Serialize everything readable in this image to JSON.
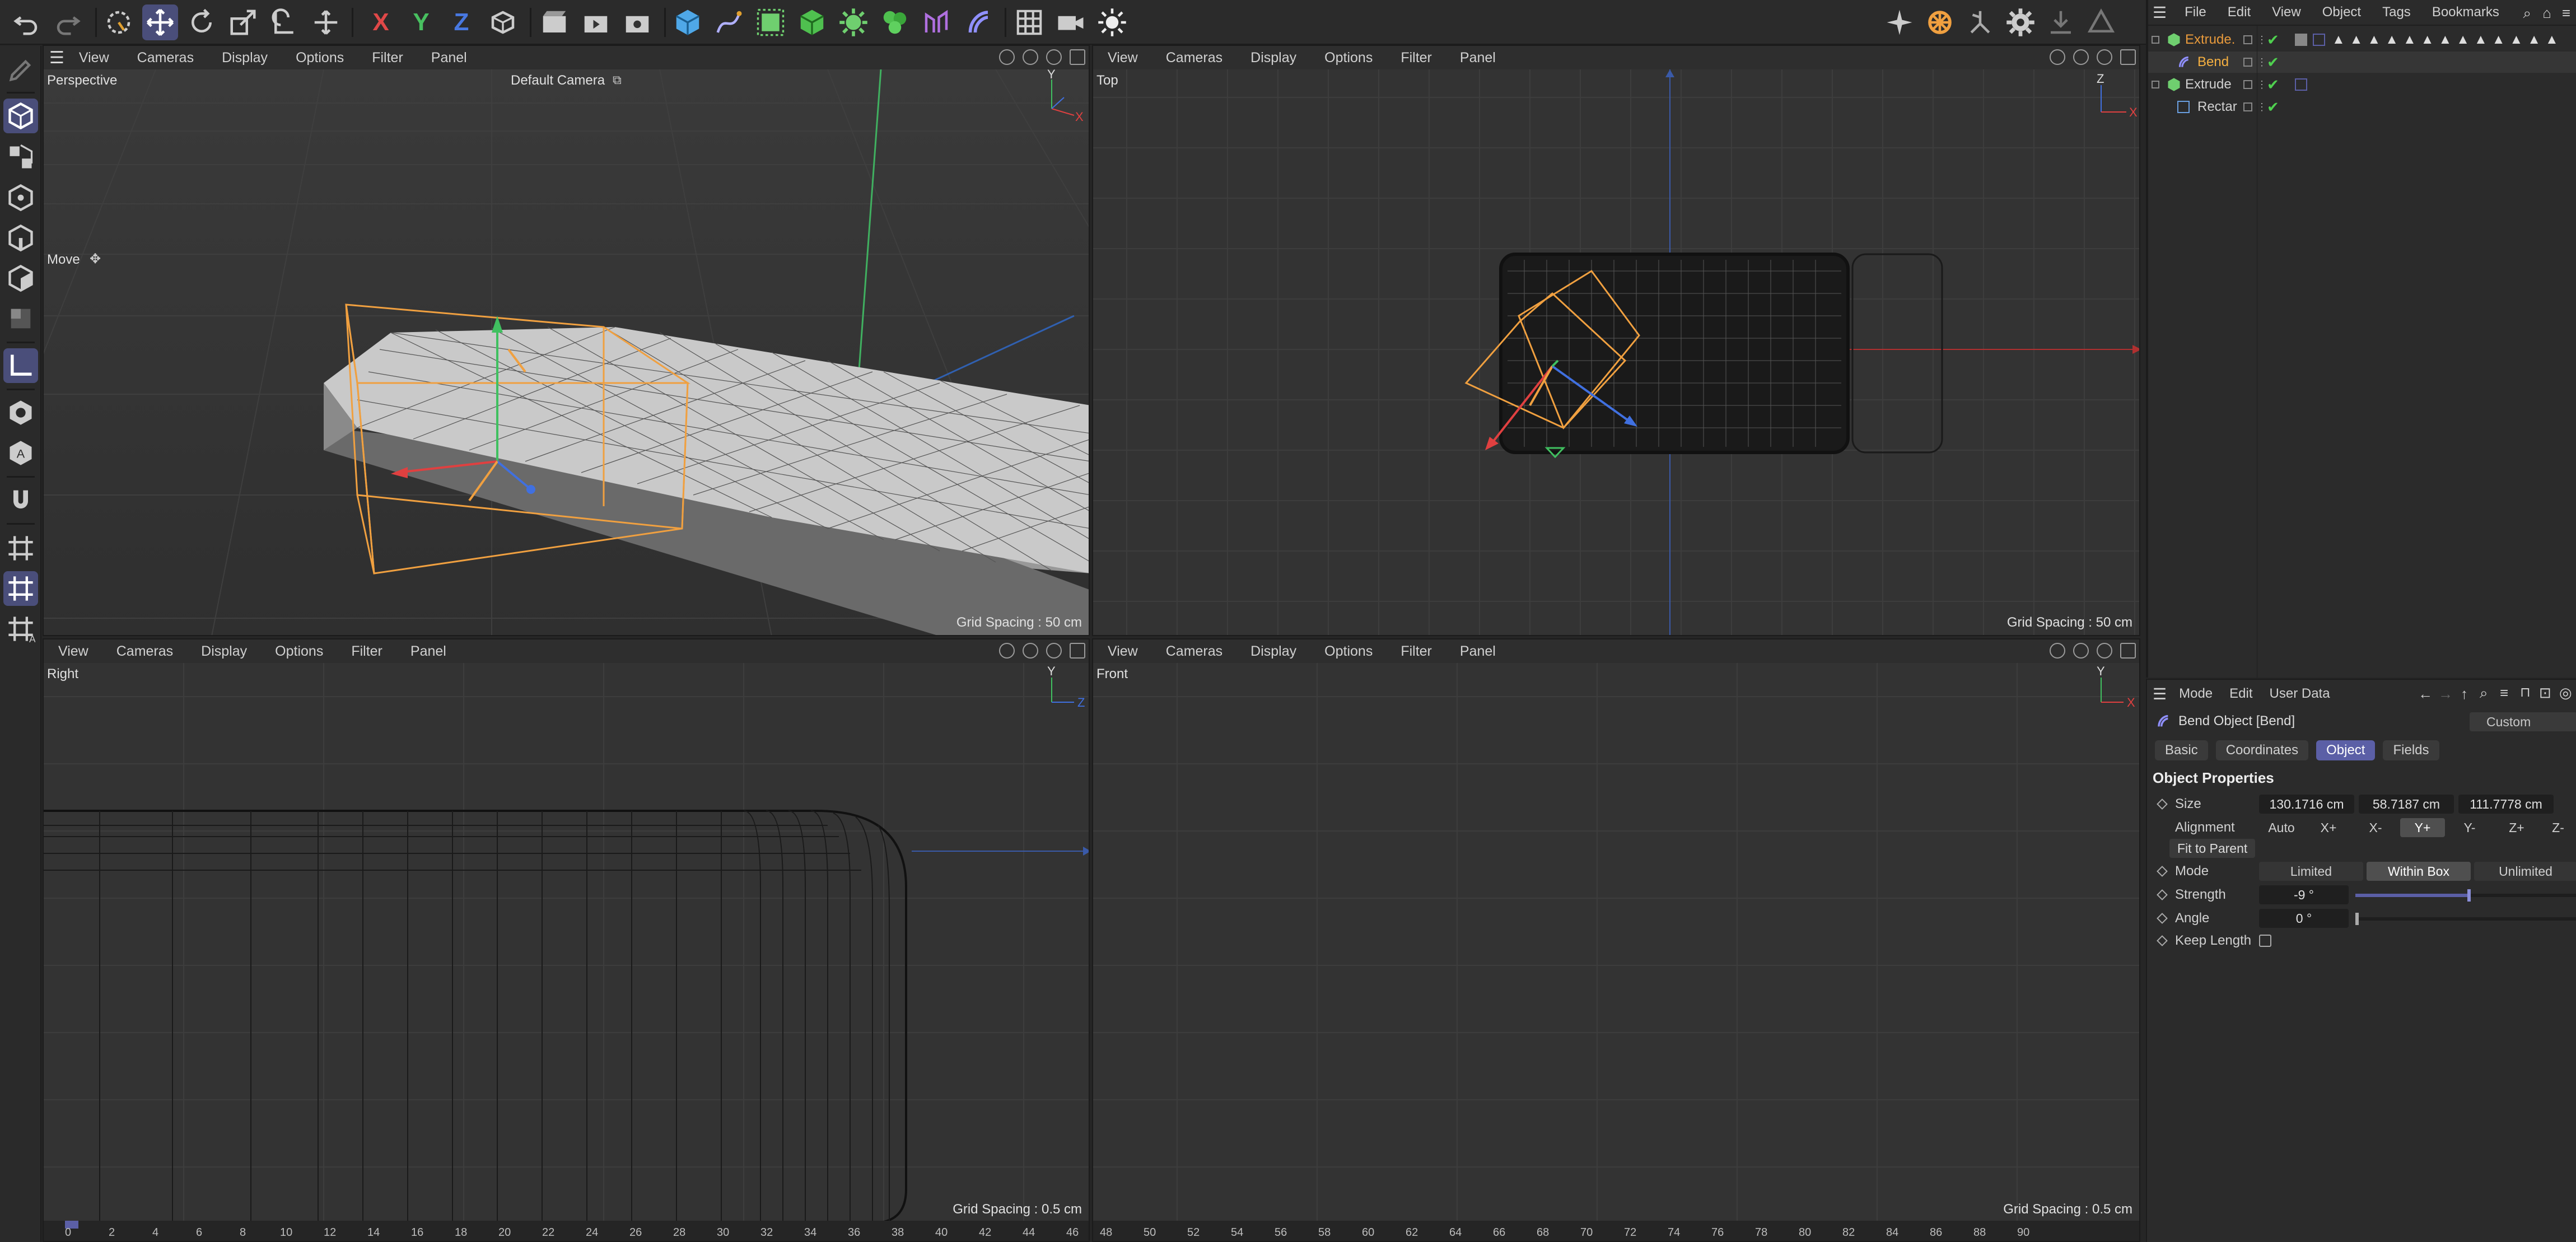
{
  "toolbar": {
    "undo": "undo-icon",
    "redo": "redo-icon",
    "axis_x": "X",
    "axis_y": "Y",
    "axis_z": "Z"
  },
  "viewports": {
    "menu": [
      "View",
      "Cameras",
      "Display",
      "Options",
      "Filter",
      "Panel"
    ],
    "perspective": {
      "name": "Perspective",
      "camera": "Default Camera",
      "tool": "Move",
      "grid": "Grid Spacing : 50 cm"
    },
    "top": {
      "name": "Top",
      "grid": "Grid Spacing : 50 cm"
    },
    "right": {
      "name": "Right",
      "grid": "Grid Spacing : 0.5 cm"
    },
    "front": {
      "name": "Front",
      "grid": "Grid Spacing : 0.5 cm"
    }
  },
  "object_manager": {
    "menu": [
      "File",
      "Edit",
      "View",
      "Object",
      "Tags",
      "Bookmarks"
    ],
    "rows": [
      {
        "name": "Extrude.",
        "color": "#e89a3c"
      },
      {
        "name": "Bend",
        "color": "#f5b041"
      },
      {
        "name": "Extrude",
        "color": "#d0d0d0"
      },
      {
        "name": "Rectar",
        "color": "#d0d0d0"
      }
    ]
  },
  "attributes": {
    "menu": [
      "Mode",
      "Edit",
      "User Data"
    ],
    "object_title": "Bend Object [Bend]",
    "preset": "Custom",
    "tabs": [
      "Basic",
      "Coordinates",
      "Object",
      "Fields"
    ],
    "active_tab": "Object",
    "section": "Object Properties",
    "size_label": "Size",
    "size": [
      "130.1716 cm",
      "58.7187 cm",
      "111.7778 cm"
    ],
    "alignment_label": "Alignment",
    "alignment_options": [
      "Auto",
      "X+",
      "X-",
      "Y+",
      "Y-",
      "Z+",
      "Z-"
    ],
    "alignment_selected": "Y+",
    "fit_button": "Fit to Parent",
    "mode_label": "Mode",
    "mode_options": [
      "Limited",
      "Within Box",
      "Unlimited"
    ],
    "mode_selected": "Within Box",
    "strength_label": "Strength",
    "strength": "-9 °",
    "angle_label": "Angle",
    "angle": "0 °",
    "keep_length_label": "Keep Length"
  },
  "rulers": {
    "right": [
      "0",
      "2",
      "4",
      "6",
      "8",
      "10",
      "12",
      "14",
      "16",
      "18",
      "20",
      "22",
      "24",
      "26",
      "28",
      "30",
      "32",
      "34",
      "36",
      "38",
      "40",
      "42",
      "44",
      "46"
    ],
    "front": [
      "48",
      "50",
      "52",
      "54",
      "56",
      "58",
      "60",
      "62",
      "64",
      "66",
      "68",
      "70",
      "72",
      "74",
      "76",
      "78",
      "80",
      "82",
      "84",
      "86",
      "88",
      "90"
    ]
  },
  "colors": {
    "accent": "#5b5fa6",
    "orange": "#f0a040",
    "x_axis": "#e04040",
    "y_axis": "#40c060",
    "z_axis": "#4070e0"
  }
}
